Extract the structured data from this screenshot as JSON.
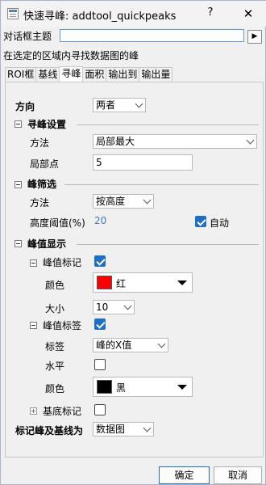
{
  "window": {
    "title": "快速寻峰: addtool_quickpeaks",
    "help_label": "?",
    "close_label": "✕"
  },
  "header": {
    "theme_label": "对话框主题",
    "theme_value": "",
    "arrow_label": "▶",
    "description": "在选定的区域内寻找数据图的峰"
  },
  "tabs": [
    {
      "label": "ROI框"
    },
    {
      "label": "基线"
    },
    {
      "label": "寻峰"
    },
    {
      "label": "面积"
    },
    {
      "label": "输出到"
    },
    {
      "label": "输出量"
    }
  ],
  "active_tab": "寻峰",
  "direction": {
    "label": "方向",
    "value": "两者"
  },
  "peak_find": {
    "section_label": "寻峰设置",
    "method_label": "方法",
    "method_value": "局部最大",
    "local_points_label": "局部点",
    "local_points_value": "5"
  },
  "peak_filter": {
    "section_label": "峰筛选",
    "method_label": "方法",
    "method_value": "按高度",
    "threshold_label": "高度阈值(%)",
    "threshold_value": "20",
    "auto_label": "自动",
    "auto_checked": true
  },
  "peak_display": {
    "section_label": "峰值显示",
    "marker_label": "峰值标记",
    "marker_checked": true,
    "marker_color_label": "颜色",
    "marker_color_name": "红",
    "marker_color_hex": "#ff0000",
    "size_label": "大小",
    "size_value": "10",
    "peak_label_label": "峰值标签",
    "peak_label_checked": true,
    "label_type_label": "标签",
    "label_type_value": "峰的X值",
    "horizontal_label": "水平",
    "horizontal_checked": false,
    "label_color_label": "颜色",
    "label_color_name": "黑",
    "label_color_hex": "#000000",
    "base_marker_label": "基底标记",
    "base_marker_checked": false
  },
  "mark_peaks": {
    "label": "标记峰及基线为",
    "value": "数据图"
  },
  "footer": {
    "ok_label": "确定",
    "cancel_label": "取消"
  }
}
